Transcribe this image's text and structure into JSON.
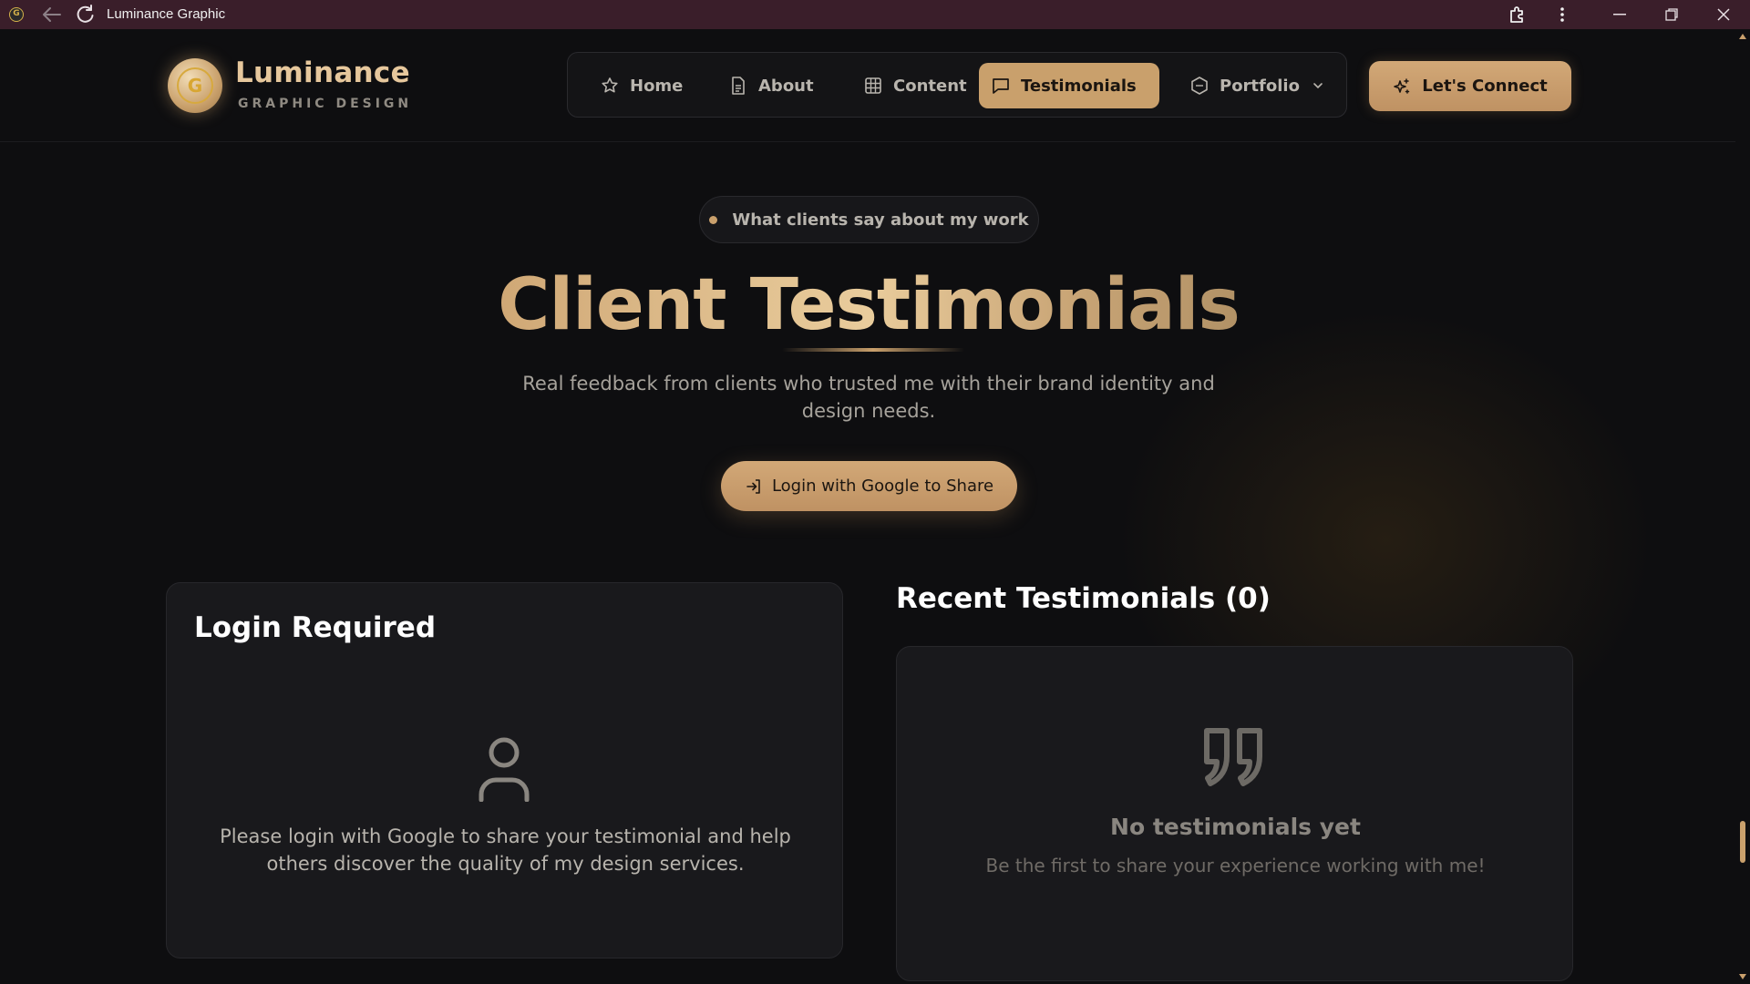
{
  "window": {
    "title": "Luminance Graphic",
    "favicon_letter": "G"
  },
  "brand": {
    "name": "Luminance",
    "subtitle": "GRAPHIC DESIGN",
    "logo_letter": "G"
  },
  "nav": {
    "items": [
      {
        "label": "Home",
        "icon": "star-icon"
      },
      {
        "label": "About",
        "icon": "document-icon"
      },
      {
        "label": "Content",
        "icon": "grid-icon"
      },
      {
        "label": "Testimonials",
        "icon": "message-icon",
        "active": true
      },
      {
        "label": "Portfolio",
        "icon": "hexagon-icon",
        "has_dropdown": true
      }
    ],
    "cta_label": "Let's Connect"
  },
  "hero": {
    "pill_text": "What clients say about my work",
    "title": "Client Testimonials",
    "subtitle": "Real feedback from clients who trusted me with their brand identity and design needs.",
    "login_button": "Login with Google to Share"
  },
  "login_card": {
    "title": "Login Required",
    "message": "Please login with Google to share your testimonial and help others discover the quality of my design services."
  },
  "recent": {
    "title": "Recent Testimonials (0)",
    "empty_title": "No testimonials yet",
    "empty_subtitle": "Be the first to share your experience working with me!"
  },
  "colors": {
    "accent": "#c9a06c",
    "background": "#0e0e10",
    "titlebar": "#3a1e2a",
    "card": "#19191c"
  }
}
